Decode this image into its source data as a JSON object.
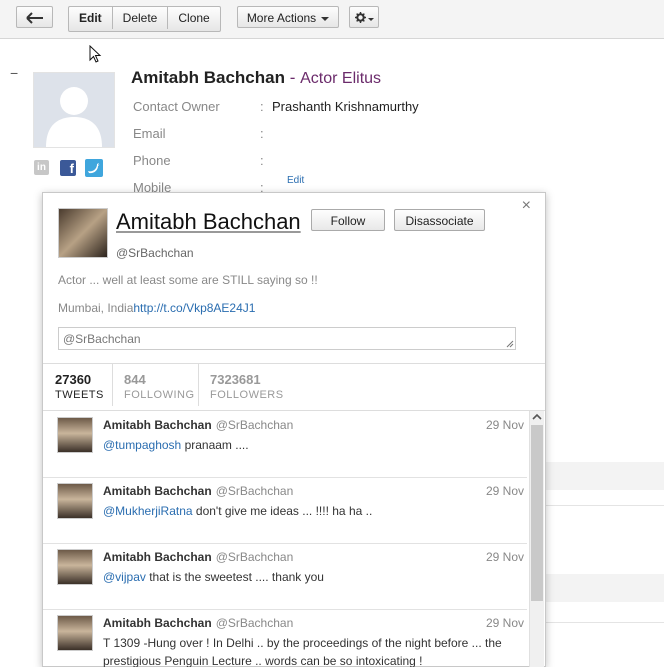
{
  "toolbar": {
    "edit": "Edit",
    "delete": "Delete",
    "clone": "Clone",
    "more_actions": "More Actions"
  },
  "contact": {
    "name": "Amitabh Bachchan",
    "separator": "-",
    "company": "Actor Elitus",
    "fields": [
      {
        "label": "Contact Owner",
        "value": "Prashanth Krishnamurthy"
      },
      {
        "label": "Email",
        "value": ""
      },
      {
        "label": "Phone",
        "value": ""
      },
      {
        "label": "Mobile",
        "value": ""
      }
    ],
    "colon": ":",
    "inline_edit": "Edit",
    "collapse": "−"
  },
  "twitter": {
    "name": "Amitabh Bachchan",
    "handle": "@SrBachchan",
    "follow": "Follow",
    "disassociate": "Disassociate",
    "close": "×",
    "bio": "Actor ... well at least some are STILL saying so !!",
    "location": "Mumbai, India",
    "url": "http://t.co/Vkp8AE24J1",
    "reply_text": "@SrBachchan",
    "stats": [
      {
        "count": "27360",
        "label": "TWEETS"
      },
      {
        "count": "844",
        "label": "FOLLOWING"
      },
      {
        "count": "7323681",
        "label": "FOLLOWERS"
      }
    ],
    "tweets": [
      {
        "name": "Amitabh Bachchan",
        "handle": "@SrBachchan",
        "date": "29 Nov",
        "mention": "@tumpaghosh",
        "text": " pranaam ...."
      },
      {
        "name": "Amitabh Bachchan",
        "handle": "@SrBachchan",
        "date": "29 Nov",
        "mention": "@MukherjiRatna",
        "text": " don't give me ideas ... !!!! ha ha .."
      },
      {
        "name": "Amitabh Bachchan",
        "handle": "@SrBachchan",
        "date": "29 Nov",
        "mention": "@vijpav",
        "text": " that is the sweetest .... thank you"
      },
      {
        "name": "Amitabh Bachchan",
        "handle": "@SrBachchan",
        "date": "29 Nov",
        "mention": "",
        "text": "T 1309 -Hung over ! In Delhi .. by the proceedings of the night before ... the prestigious Penguin Lecture .. words can be so intoxicating !"
      }
    ]
  }
}
